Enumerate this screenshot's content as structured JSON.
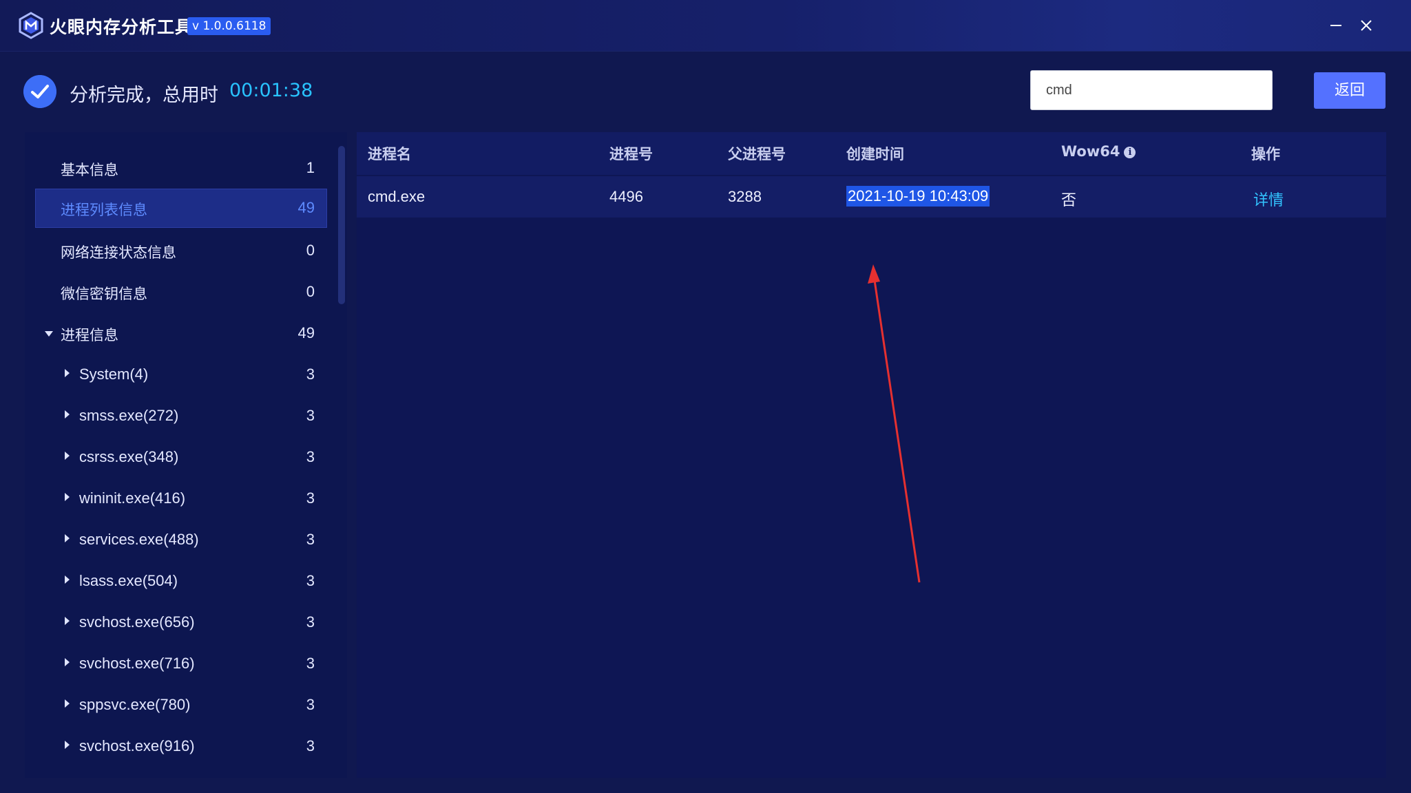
{
  "window": {
    "title": "火眼内存分析工具",
    "version": "v 1.0.0.6118"
  },
  "status": {
    "text": "分析完成，总用时",
    "elapsed": "00:01:38"
  },
  "search": {
    "value": "cmd"
  },
  "toolbar": {
    "back_label": "返回"
  },
  "sidebar": {
    "items": [
      {
        "label": "基本信息",
        "count": "1"
      },
      {
        "label": "进程列表信息",
        "count": "49"
      },
      {
        "label": "网络连接状态信息",
        "count": "0"
      },
      {
        "label": "微信密钥信息",
        "count": "0"
      },
      {
        "label": "进程信息",
        "count": "49"
      }
    ],
    "processes": [
      {
        "label": "System(4)",
        "count": "3"
      },
      {
        "label": "smss.exe(272)",
        "count": "3"
      },
      {
        "label": "csrss.exe(348)",
        "count": "3"
      },
      {
        "label": "wininit.exe(416)",
        "count": "3"
      },
      {
        "label": "services.exe(488)",
        "count": "3"
      },
      {
        "label": "lsass.exe(504)",
        "count": "3"
      },
      {
        "label": "svchost.exe(656)",
        "count": "3"
      },
      {
        "label": "svchost.exe(716)",
        "count": "3"
      },
      {
        "label": "sppsvc.exe(780)",
        "count": "3"
      },
      {
        "label": "svchost.exe(916)",
        "count": "3"
      }
    ]
  },
  "table": {
    "columns": [
      "进程名",
      "进程号",
      "父进程号",
      "创建时间",
      "Wow64",
      "操作"
    ],
    "rows": [
      {
        "name": "cmd.exe",
        "pid": "4496",
        "ppid": "3288",
        "created": "2021-10-19 10:43:09",
        "wow64": "否",
        "action": "详情"
      }
    ]
  },
  "colors": {
    "background": "#101850",
    "accent": "#5471ff",
    "time_highlight": "#29c3ff",
    "link": "#32c4ff",
    "annotation_arrow": "#e53030"
  },
  "icons": [
    "app-logo-icon",
    "minimize-icon",
    "close-icon",
    "check-circle-icon",
    "info-icon",
    "caret-down-icon",
    "caret-right-icon"
  ]
}
